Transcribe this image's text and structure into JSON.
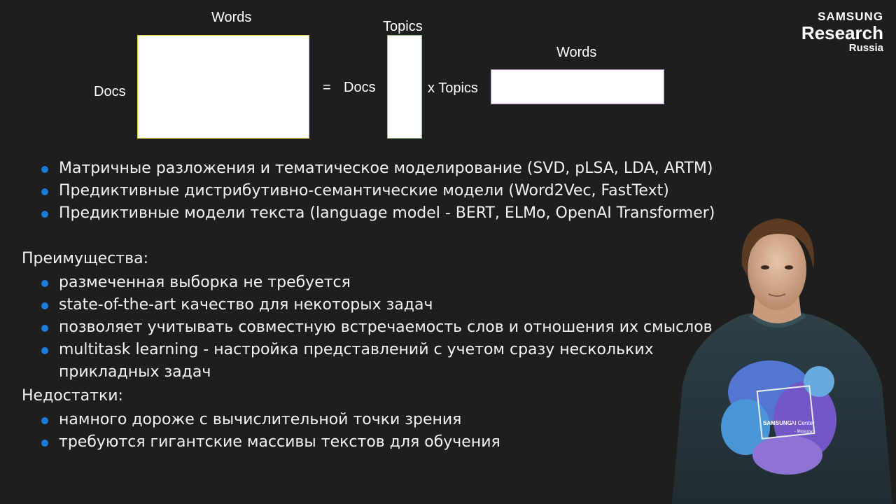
{
  "diagram": {
    "words_top_left": "Words",
    "docs_left": "Docs",
    "equals": "=",
    "docs_middle": "Docs",
    "topics_top": "Topics",
    "x_topics": "x Topics",
    "words_right": "Words"
  },
  "methods": [
    "Матричные разложения и тематическое моделирование (SVD, pLSA, LDA, ARTM)",
    "Предиктивные дистрибутивно-семантические модели (Word2Vec, FastText)",
    "Предиктивные модели текста (language model - BERT, ELMo, OpenAI Transformer)"
  ],
  "advantages": {
    "heading": "Преимущества:",
    "items": [
      "размеченная выборка не требуется",
      "state-of-the-art качество для некоторых задач",
      "позволяет учитывать совместную встречаемость слов и отношения их смыслов",
      "multitask learning - настройка представлений с учетом сразу нескольких прикладных задач"
    ]
  },
  "disadvantages": {
    "heading": "Недостатки:",
    "items": [
      "намного дороже с вычислительной точки зрения",
      "требуются гигантские массивы текстов для обучения"
    ]
  },
  "logo": {
    "line1": "SAMSUNG",
    "line2": "Research",
    "line3": "Russia"
  },
  "shirt_print": {
    "brand": "SAMSUNG",
    "text": "AI Center",
    "sub": "- Moscow"
  },
  "colors": {
    "background": "#1e1e1e",
    "bullet": "#1b7bd9",
    "matrix_fill": "#ffffff"
  }
}
